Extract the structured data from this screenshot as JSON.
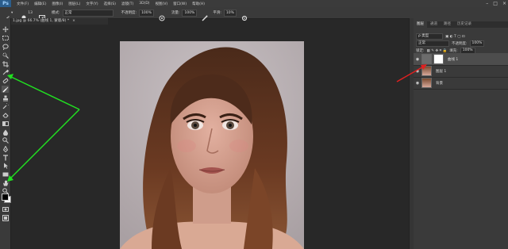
{
  "menubar": {
    "logo": "Ps",
    "items": [
      "文件(F)",
      "编辑(E)",
      "图像(I)",
      "图层(L)",
      "文字(Y)",
      "选择(S)",
      "滤镜(T)",
      "3D(D)",
      "视图(V)",
      "窗口(W)",
      "帮助(H)"
    ],
    "window_controls": [
      "–",
      "□",
      "×"
    ]
  },
  "options": {
    "brush_size": "13",
    "mode_label": "模式:",
    "mode_value": "正常",
    "opacity_label": "不透明度:",
    "opacity_value": "100%",
    "flow_label": "流量:",
    "flow_value": "100%",
    "smooth_label": "平滑:",
    "smooth_value": "10%"
  },
  "document": {
    "tab_title": "1.jpg @ 66.7% (曲线 1, 蒙版/8) *",
    "close": "×"
  },
  "panel": {
    "tabs": [
      "图层",
      "通道",
      "路径",
      "历史记录"
    ],
    "kind_label": "ρ 类型",
    "blend_mode": "正常",
    "opacity_label": "不透明度:",
    "opacity_value": "100%",
    "lock_label": "锁定:",
    "fill_label": "填充:",
    "fill_value": "100%",
    "layers": [
      {
        "name": "曲线 1",
        "selected": true,
        "has_mask": true
      },
      {
        "name": "图层 1",
        "selected": false,
        "has_mask": false
      },
      {
        "name": "背景",
        "selected": false,
        "has_mask": false
      }
    ]
  },
  "colors": {
    "annotation_green": "#21e021",
    "annotation_red": "#e02020",
    "foreground": "#000000",
    "background": "#ffffff"
  },
  "tools": [
    "move-icon",
    "marquee-icon",
    "lasso-icon",
    "quick-select-icon",
    "crop-icon",
    "eyedropper-icon",
    "healing-brush-icon",
    "brush-icon",
    "clone-stamp-icon",
    "history-brush-icon",
    "eraser-icon",
    "gradient-icon",
    "blur-icon",
    "dodge-icon",
    "pen-icon",
    "type-icon",
    "path-select-icon",
    "rectangle-icon",
    "hand-icon",
    "zoom-icon",
    "more-icon"
  ]
}
